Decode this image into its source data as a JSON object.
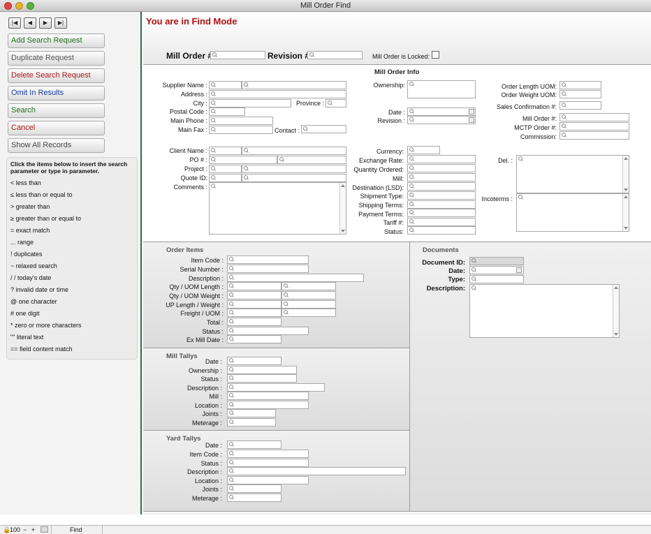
{
  "window": {
    "title": "Mill Order Find"
  },
  "sidebar": {
    "buttons": [
      {
        "label": "Add Search Request",
        "color": "#1f6b1f"
      },
      {
        "label": "Duplicate Request",
        "color": "#555555"
      },
      {
        "label": "Delete Search Request",
        "color": "#b01515"
      },
      {
        "label": "Omit In Results",
        "color": "#1a3c9a"
      },
      {
        "label": "Search",
        "color": "#1f6b1f"
      },
      {
        "label": "Cancel",
        "color": "#b01515"
      },
      {
        "label": "Show All Records",
        "color": "#444444"
      }
    ],
    "help_heading": "Click the items below to insert the search parameter or type in parameter.",
    "operators": [
      "< less than",
      "≤ less than or equal to",
      "> greater than",
      "≥ greater than or equal to",
      "= exact match",
      "... range",
      "! duplicates",
      "~ relaxed search",
      "/ / today's date",
      "? invalid date or time",
      "@ one character",
      "# one digit",
      "* zero or more characters",
      "\"\" literal text",
      "== field content match"
    ]
  },
  "main": {
    "find_mode": "You are in Find Mode",
    "header": {
      "mill_order": "Mill Order #",
      "revision": "Revision #",
      "locked": "Mill Order is Locked:"
    },
    "info_title": "Mill Order Info",
    "supplier": {
      "supplier_name": "Supplier Name :",
      "address": "Address :",
      "city": "City :",
      "province": "Province :",
      "postal_code": "Postal Code :",
      "main_phone": "Main Phone :",
      "main_fax": "Main Fax :",
      "contact": "Contact :"
    },
    "client": {
      "client_name": "Client Name :",
      "po": "PO # :",
      "project": "Project :",
      "quote_id": "Quote ID:",
      "comments": "Comments :"
    },
    "mid": {
      "ownership": "Ownership:",
      "date": "Date :",
      "revision": "Revision :",
      "currency": "Currency:",
      "exchange_rate": "Exchange Rate:",
      "quantity_ordered": "Quantity Ordered:",
      "mill": "Mill:",
      "destination": "Destination (LSD):",
      "shipment_type": "Shipment Type:",
      "shipping_terms": "Shipping Terms:",
      "payment_terms": "Payment Terms:",
      "tariff": "Tariff #:",
      "status": "Status:"
    },
    "right": {
      "order_length_uom": "Order Length UOM:",
      "order_weight_uom": "Order Weight UOM:",
      "sales_confirmation": "Sales Confirmation #:",
      "mill_order": "Mill Order #:",
      "mctp_order": "MCTP Order #:",
      "commission": "Commission:",
      "del": "Del. :",
      "incoterms": "Incoterms :"
    },
    "order_items": {
      "title": "Order Items",
      "item_code": "Item Code :",
      "serial_number": "Serial Number :",
      "description": "Description :",
      "qty_uom_length": "Qty / UOM Length :",
      "qty_uom_weight": "Qty / UOM Weight :",
      "up_length_weight": "UP Length / Weight :",
      "freight_uom": "Freight / UOM :",
      "total": "Total :",
      "status": "Status :",
      "ex_mill_date": "Ex Mill Date :"
    },
    "documents": {
      "title": "Documents",
      "document_id": "Document ID:",
      "date": "Date:",
      "type": "Type:",
      "description": "Description:"
    },
    "mill_tallys": {
      "title": "Mill Tallys",
      "date": "Date :",
      "ownership": "Ownership :",
      "status": "Status :",
      "description": "Description :",
      "mill": "Mill :",
      "location": "Location :",
      "joints": "Joints :",
      "meterage": "Meterage :"
    },
    "yard_tallys": {
      "title": "Yard Tallys",
      "date": "Date :",
      "item_code": "Item Code :",
      "status": "Status :",
      "description": "Description :",
      "location": "Location :",
      "joints": "Joints :",
      "meterage": "Meterage :"
    }
  },
  "statusbar": {
    "zoom": "100",
    "mode": "Find"
  }
}
